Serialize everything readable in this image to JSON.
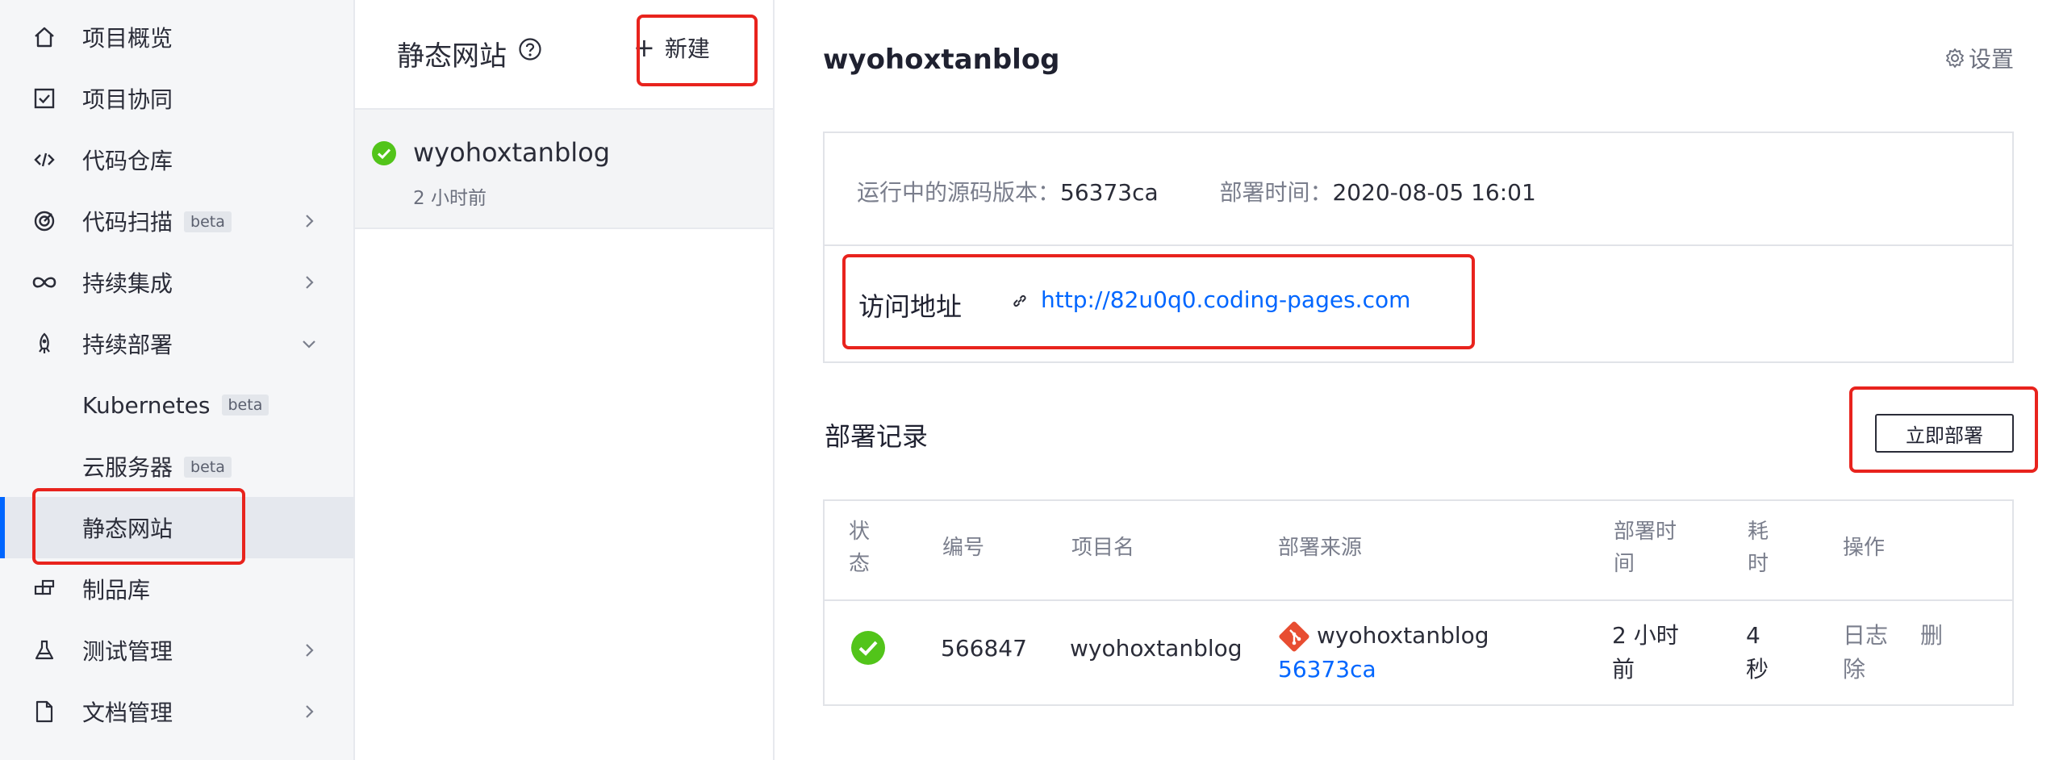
{
  "sidebar": {
    "items": [
      {
        "label": "项目概览",
        "icon": "home-icon"
      },
      {
        "label": "项目协同",
        "icon": "checkbox-icon"
      },
      {
        "label": "代码仓库",
        "icon": "code-icon"
      },
      {
        "label": "代码扫描",
        "badge": "beta",
        "icon": "scan-icon",
        "chevron": "right"
      },
      {
        "label": "持续集成",
        "icon": "infinity-icon",
        "chevron": "right"
      },
      {
        "label": "持续部署",
        "icon": "rocket-icon",
        "chevron": "down"
      },
      {
        "label": "Kubernetes",
        "badge": "beta"
      },
      {
        "label": "云服务器",
        "badge": "beta"
      },
      {
        "label": "静态网站",
        "active": true
      },
      {
        "label": "制品库",
        "icon": "artifact-icon"
      },
      {
        "label": "测试管理",
        "icon": "flask-icon",
        "chevron": "right"
      },
      {
        "label": "文档管理",
        "icon": "document-icon",
        "chevron": "right"
      }
    ]
  },
  "list_panel": {
    "title": "静态网站",
    "new_label": "新建",
    "sites": [
      {
        "name": "wyohoxtanblog",
        "time": "2 小时前",
        "status": "success"
      }
    ]
  },
  "main": {
    "title": "wyohoxtanblog",
    "settings_label": "设置",
    "source_version_label": "运行中的源码版本：",
    "source_version": "56373ca",
    "deploy_time_label": "部署时间：",
    "deploy_time": "2020-08-05 16:01",
    "visit_label": "访问地址",
    "visit_url": "http://82u0q0.coding-pages.com",
    "records_title": "部署记录",
    "deploy_now_label": "立即部署",
    "table": {
      "headers": {
        "status": [
          "状",
          "态"
        ],
        "number": "编号",
        "project": "项目名",
        "source": "部署来源",
        "time": [
          "部署时",
          "间"
        ],
        "duration": [
          "耗",
          "时"
        ],
        "ops": "操作"
      },
      "rows": [
        {
          "status": "success",
          "number": "566847",
          "project": "wyohoxtanblog",
          "source_repo": "wyohoxtanblog",
          "source_commit": "56373ca",
          "time": [
            "2 小时",
            "前"
          ],
          "duration": [
            "4",
            "秒"
          ],
          "op_log": "日志",
          "op_delete": [
            "删",
            "除"
          ]
        }
      ]
    }
  },
  "colors": {
    "accent": "#0066ff",
    "success": "#52c41a",
    "highlight": "#e8231d",
    "git": "#e84d31"
  }
}
